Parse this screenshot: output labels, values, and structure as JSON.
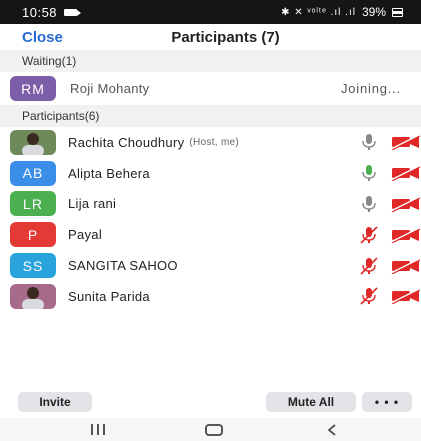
{
  "status_bar": {
    "time": "10:58",
    "symbols": "✱ ✕ ᵛᵒˡᵗᵉ .ıl .ıl",
    "battery": "39%"
  },
  "header": {
    "close_label": "Close",
    "title": "Participants (7)"
  },
  "waiting": {
    "heading": "Waiting(1)",
    "person": {
      "initials": "RM",
      "name": "Roji Mohanty",
      "status": "Joining...",
      "color": "#7b5ea7"
    }
  },
  "participants": {
    "heading": "Participants(6)",
    "items": [
      {
        "initials": "",
        "name": "Rachita Choudhury",
        "role": "(Host, me)",
        "color": "#6f8a5a",
        "mic": "muted-gray"
      },
      {
        "initials": "AB",
        "name": "Alipta Behera",
        "role": "",
        "color": "#3b8ee8",
        "mic": "active-green"
      },
      {
        "initials": "LR",
        "name": "Lija rani",
        "role": "",
        "color": "#4caf50",
        "mic": "muted-gray"
      },
      {
        "initials": "P",
        "name": "Payal",
        "role": "",
        "color": "#e53935",
        "mic": "muted-red"
      },
      {
        "initials": "SS",
        "name": "SANGITA SAHOO",
        "role": "",
        "color": "#29a3dc",
        "mic": "muted-red"
      },
      {
        "initials": "",
        "name": "Sunita Parida",
        "role": "",
        "color": "#a76a8a",
        "mic": "muted-red"
      }
    ]
  },
  "toolbar": {
    "invite_label": "Invite",
    "mute_all_label": "Mute All",
    "more_label": "• • •"
  },
  "colors": {
    "accent": "#2a6bd1",
    "muted_red": "#e02828",
    "active_green": "#4caf50"
  }
}
